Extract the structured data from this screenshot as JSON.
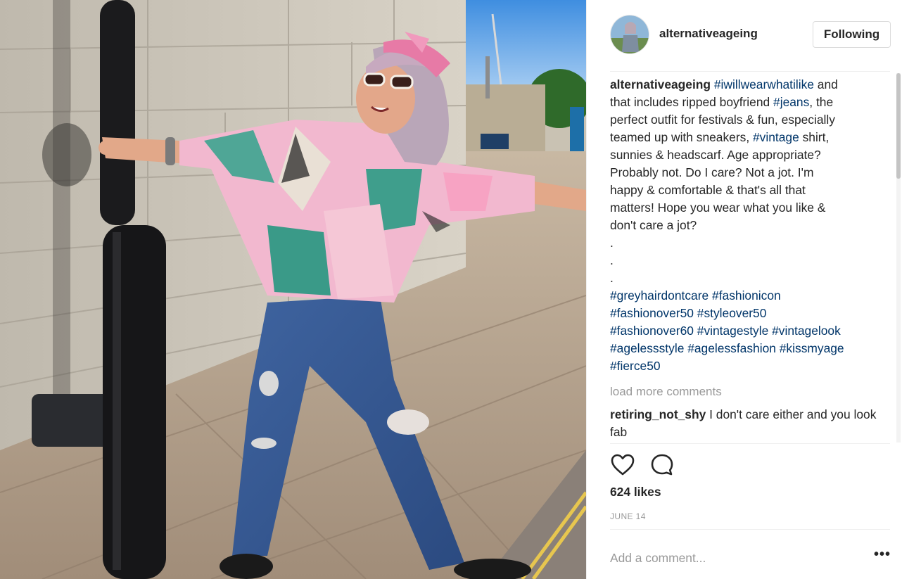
{
  "post": {
    "photo_alt": "Photo",
    "username": "alternativeageing",
    "follow_label": "Following",
    "caption": {
      "author": "alternativeageing",
      "lines": [
        [
          {
            "t": "tag",
            "v": "#iwillwearwhatilike"
          },
          {
            "t": "text",
            "v": " and"
          }
        ],
        [
          {
            "t": "text",
            "v": "that includes ripped boyfriend "
          },
          {
            "t": "tag",
            "v": "#jeans"
          },
          {
            "t": "text",
            "v": ", the"
          }
        ],
        [
          {
            "t": "text",
            "v": "perfect outfit for festivals & fun, especially"
          }
        ],
        [
          {
            "t": "text",
            "v": "teamed up with sneakers, "
          },
          {
            "t": "tag",
            "v": "#vintage"
          },
          {
            "t": "text",
            "v": " shirt,"
          }
        ],
        [
          {
            "t": "text",
            "v": "sunnies & headscarf. Age appropriate?"
          }
        ],
        [
          {
            "t": "text",
            "v": "Probably not. Do I care? Not a jot. I'm"
          }
        ],
        [
          {
            "t": "text",
            "v": "happy & comfortable & that's all that"
          }
        ],
        [
          {
            "t": "text",
            "v": "matters! Hope you wear what you like &"
          }
        ],
        [
          {
            "t": "text",
            "v": "don't care a jot?"
          }
        ]
      ],
      "dots": [
        ".",
        ".",
        "."
      ],
      "hashtag_lines": [
        [
          "#greyhairdontcare",
          "#fashionicon"
        ],
        [
          "#fashionover50",
          "#styleover50"
        ],
        [
          "#fashionover60",
          "#vintagestyle",
          "#vintagelook"
        ],
        [
          "#agelessstyle",
          "#agelessfashion",
          "#kissmyage"
        ],
        [
          "#fierce50"
        ]
      ]
    },
    "load_more_label": "load more comments",
    "comments": [
      {
        "author": "retiring_not_shy",
        "text": "I don't care either and you look fab"
      }
    ],
    "actions": {
      "like_icon": "heart-icon",
      "comment_icon": "speech-bubble-icon"
    },
    "likes": "624 likes",
    "date": "JUNE 14",
    "add_comment_placeholder": "Add a comment...",
    "more_options_label": "•••"
  },
  "colors": {
    "text": "#262626",
    "hashtag": "#003569",
    "muted": "#999999",
    "border": "#dbdbdb"
  }
}
